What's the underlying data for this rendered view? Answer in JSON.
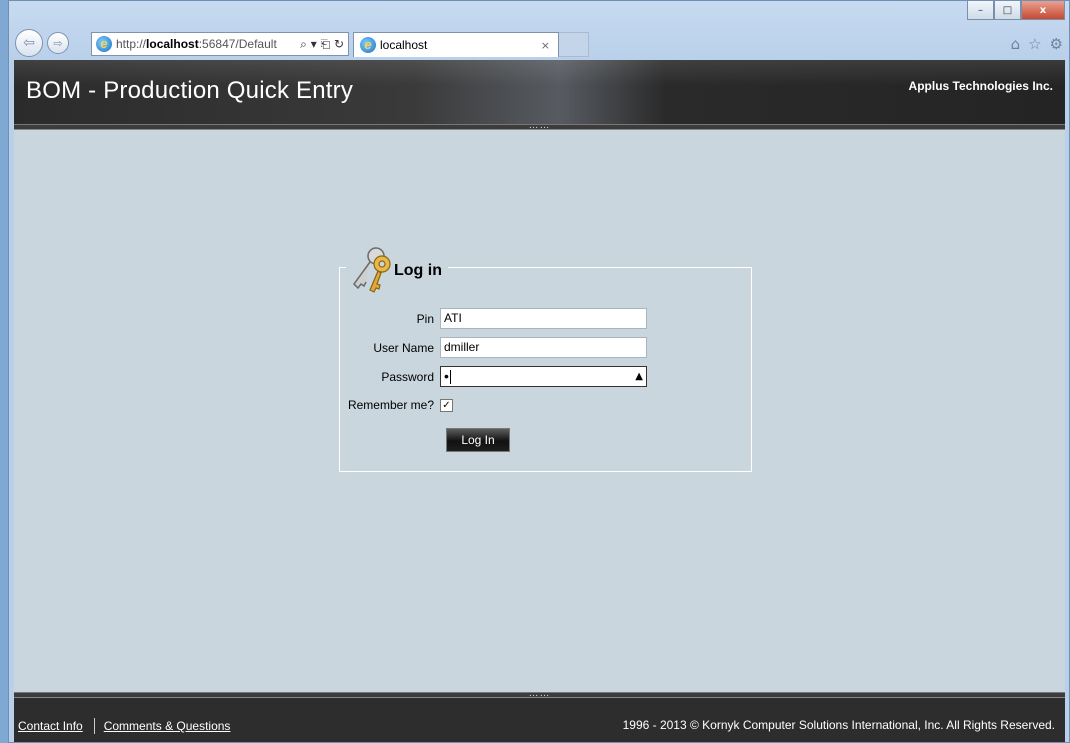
{
  "browser": {
    "address_url_prefix": "http://",
    "address_url_host": "localhost",
    "address_url_rest": ":56847/Default",
    "address_tools": "⌕ ▾ ⎗ ↻",
    "tab_title": "localhost",
    "tab_close": "×",
    "back_glyph": "⇦",
    "forward_glyph": "⇨",
    "window_buttons": {
      "minimize": "–",
      "maximize": "□",
      "close": "x"
    },
    "right_icons": {
      "home": "⌂",
      "favorites": "☆",
      "tools": "⚙"
    }
  },
  "header": {
    "title": "BOM - Production Quick Entry",
    "company": "Applus Technologies Inc."
  },
  "splitter_grip": "……",
  "login": {
    "legend": "Log in",
    "pin_label": "Pin",
    "pin_value": "ATI",
    "username_label": "User Name",
    "username_value": "dmiller",
    "password_label": "Password",
    "password_mask": "•",
    "password_reveal_icon": "eye-icon",
    "remember_label": "Remember me?",
    "remember_checked": true,
    "remember_check_glyph": "✓",
    "button_label": "Log In"
  },
  "footer": {
    "contact": "Contact Info",
    "comments": "Comments & Questions",
    "copyright": "1996 - 2013 © Kornyk Computer Solutions International, Inc. All Rights Reserved."
  },
  "colors": {
    "page_bg": "#c9d6dd",
    "header_bg": "#2b2b2b",
    "footer_bg": "#2d2d2d",
    "window_frame": "#b9d0ea"
  }
}
